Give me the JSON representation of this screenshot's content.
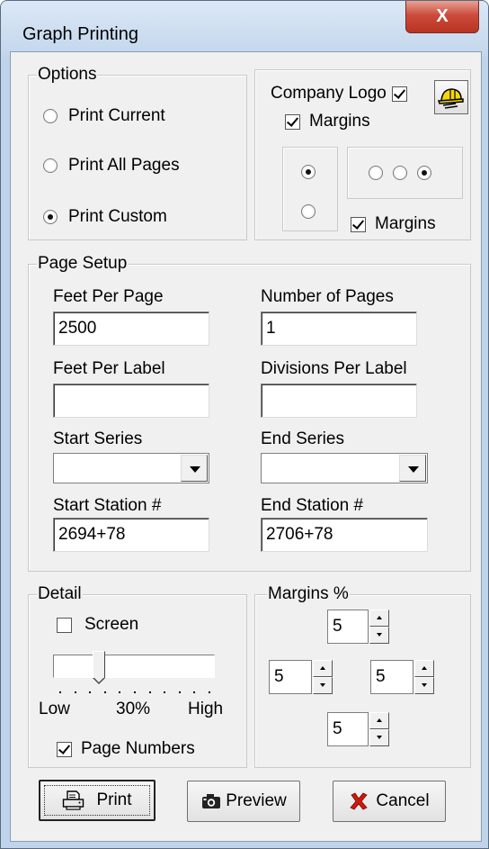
{
  "window": {
    "title": "Graph Printing",
    "close_glyph": "X"
  },
  "options": {
    "group_label": "Options",
    "radios": [
      {
        "label": "Print Current",
        "selected": false
      },
      {
        "label": "Print All Pages",
        "selected": false
      },
      {
        "label": "Print Custom",
        "selected": true
      }
    ]
  },
  "logo": {
    "company_logo_label": "Company Logo",
    "company_logo_checked": true,
    "logo_icon": "hardhat-icon",
    "margins_label_1": "Margins",
    "margins_checked_1": true,
    "vertical_radios": [
      {
        "selected": true
      },
      {
        "selected": false
      }
    ],
    "horizontal_radios": [
      {
        "selected": false
      },
      {
        "selected": false
      },
      {
        "selected": true
      }
    ],
    "margins_label_2": "Margins",
    "margins_checked_2": true
  },
  "page_setup": {
    "group_label": "Page Setup",
    "feet_per_page_label": "Feet Per Page",
    "feet_per_page_value": "2500",
    "number_of_pages_label": "Number of Pages",
    "number_of_pages_value": "1",
    "feet_per_label_label": "Feet Per Label",
    "feet_per_label_value": "",
    "divisions_per_label_label": "Divisions Per Label",
    "divisions_per_label_value": "",
    "start_series_label": "Start Series",
    "start_series_value": "",
    "end_series_label": "End Series",
    "end_series_value": "",
    "start_station_label": "Start Station #",
    "start_station_value": "2694+78",
    "end_station_label": "End Station #",
    "end_station_value": "2706+78"
  },
  "detail": {
    "group_label": "Detail",
    "screen_label": "Screen",
    "screen_checked": false,
    "slider_value_percent": 30,
    "low_label": "Low",
    "value_label": "30%",
    "high_label": "High",
    "page_numbers_label": "Page Numbers",
    "page_numbers_checked": true
  },
  "margins": {
    "group_label": "Margins %",
    "top": "5",
    "left": "5",
    "right": "5",
    "bottom": "5"
  },
  "buttons": {
    "print_label": "Print",
    "print_icon": "printer-icon",
    "preview_label": "Preview",
    "preview_icon": "camera-icon",
    "cancel_label": "Cancel",
    "cancel_icon": "x-icon",
    "cancel_icon_color": "#cc1a0e"
  }
}
